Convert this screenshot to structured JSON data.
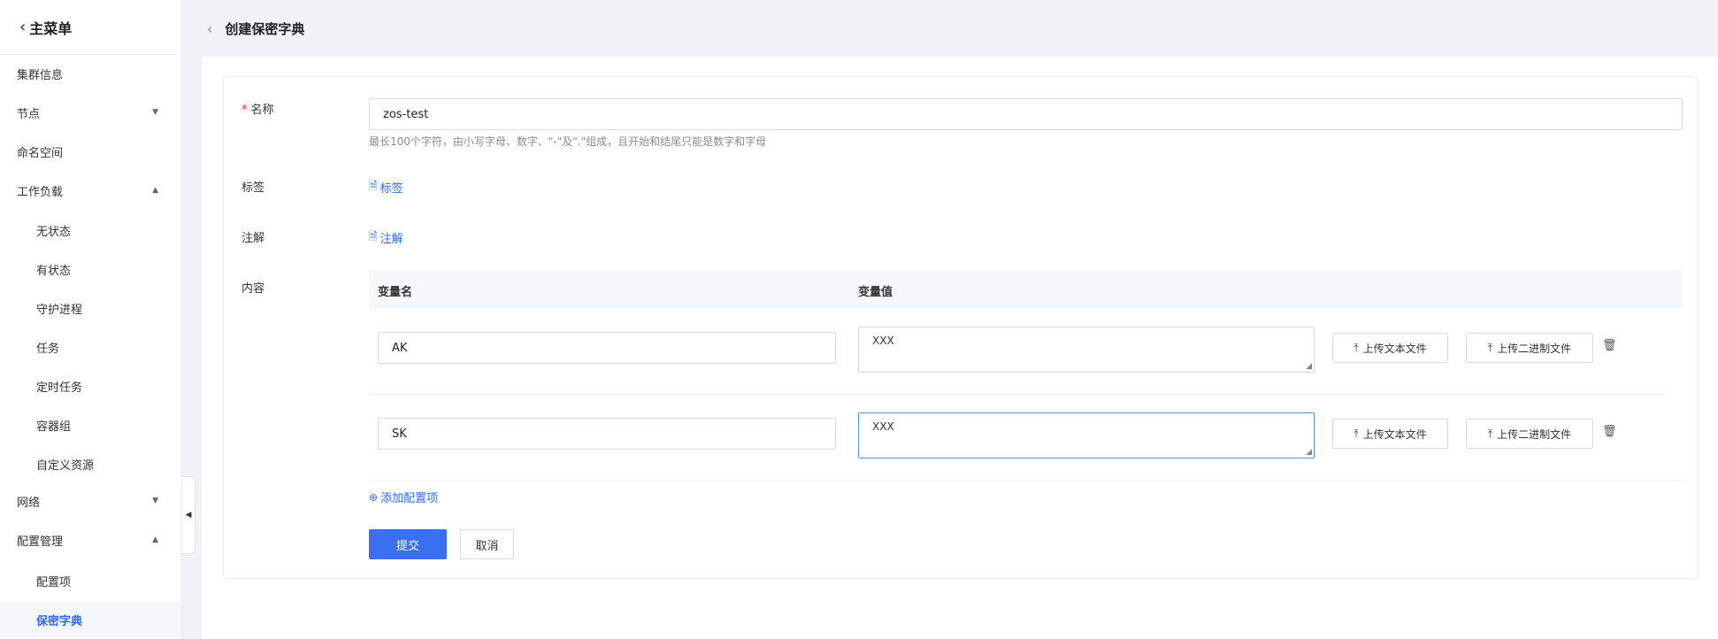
{
  "sidebar": {
    "back_label": "主菜单",
    "items": [
      {
        "label": "集群信息",
        "level": 1,
        "arrow": ""
      },
      {
        "label": "节点",
        "level": 1,
        "arrow": "▼"
      },
      {
        "label": "命名空间",
        "level": 1,
        "arrow": ""
      },
      {
        "label": "工作负载",
        "level": 1,
        "arrow": "▲"
      },
      {
        "label": "无状态",
        "level": 2,
        "arrow": ""
      },
      {
        "label": "有状态",
        "level": 2,
        "arrow": ""
      },
      {
        "label": "守护进程",
        "level": 2,
        "arrow": ""
      },
      {
        "label": "任务",
        "level": 2,
        "arrow": ""
      },
      {
        "label": "定时任务",
        "level": 2,
        "arrow": ""
      },
      {
        "label": "容器组",
        "level": 2,
        "arrow": ""
      },
      {
        "label": "自定义资源",
        "level": 2,
        "arrow": ""
      },
      {
        "label": "网络",
        "level": 1,
        "arrow": "▼"
      },
      {
        "label": "配置管理",
        "level": 1,
        "arrow": "▲"
      },
      {
        "label": "配置项",
        "level": 2,
        "arrow": ""
      },
      {
        "label": "保密字典",
        "level": 2,
        "arrow": "",
        "active": true
      }
    ]
  },
  "header": {
    "title": "创建保密字典"
  },
  "form": {
    "name": {
      "label": "名称",
      "value": "zos-test",
      "hint": "最长100个字符，由小写字母、数字、\"-\"及\".\"组成，且开始和结尾只能是数字和字母"
    },
    "labels": {
      "label": "标签",
      "link": "标签"
    },
    "annotations": {
      "label": "注解",
      "link": "注解"
    },
    "content": {
      "label": "内容",
      "col_key": "变量名",
      "col_value": "变量值",
      "rows": [
        {
          "key": "AK",
          "value": "XXX"
        },
        {
          "key": "SK",
          "value": "XXX"
        }
      ],
      "upload_text": "上传文本文件",
      "upload_binary": "上传二进制文件",
      "add_label": "添加配置项"
    },
    "submit": "提交",
    "cancel": "取消"
  }
}
